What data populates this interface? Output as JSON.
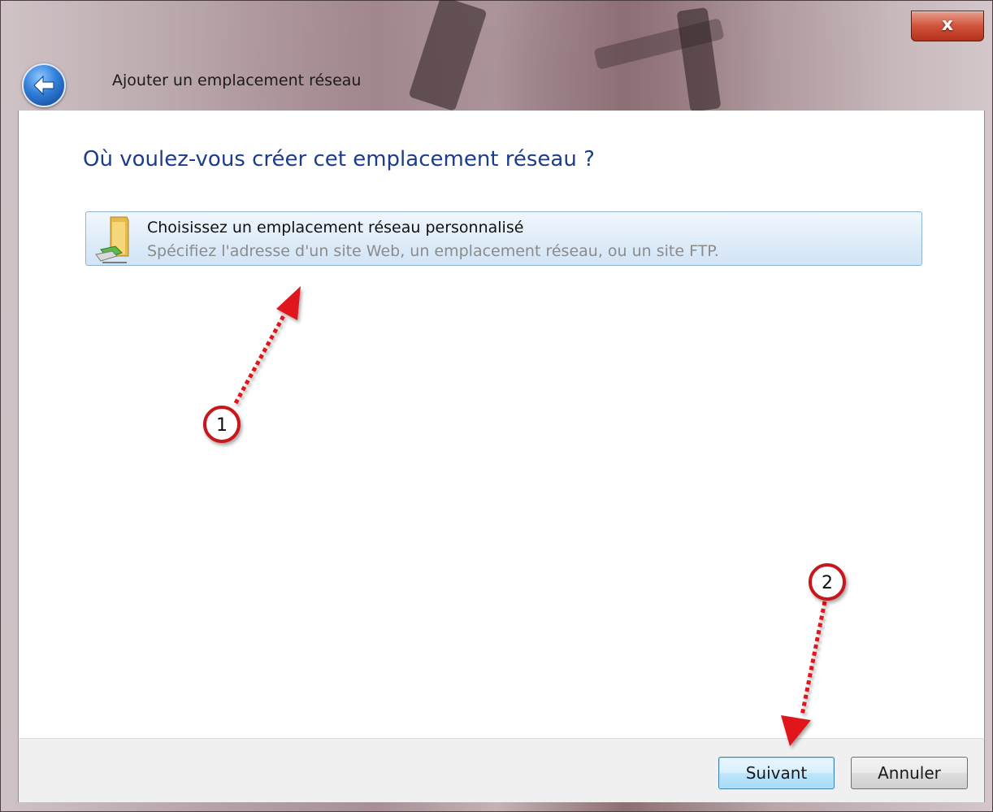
{
  "window": {
    "title": "Ajouter un emplacement réseau",
    "close_glyph": "x",
    "back_icon": "back-arrow-icon"
  },
  "main": {
    "heading": "Où voulez-vous créer cet emplacement réseau ?",
    "option": {
      "icon": "network-folder-icon",
      "title": "Choisissez un emplacement réseau personnalisé",
      "description": "Spécifiez l'adresse d'un site Web, un emplacement réseau, ou un site FTP."
    }
  },
  "footer": {
    "next_label": "Suivant",
    "cancel_label": "Annuler"
  },
  "annotations": {
    "marker1": "1",
    "marker2": "2",
    "arrow_color": "#e0191b"
  },
  "colors": {
    "heading": "#1d3d8a",
    "option_border": "#8fb4d9",
    "close_button": "#c7432b"
  }
}
